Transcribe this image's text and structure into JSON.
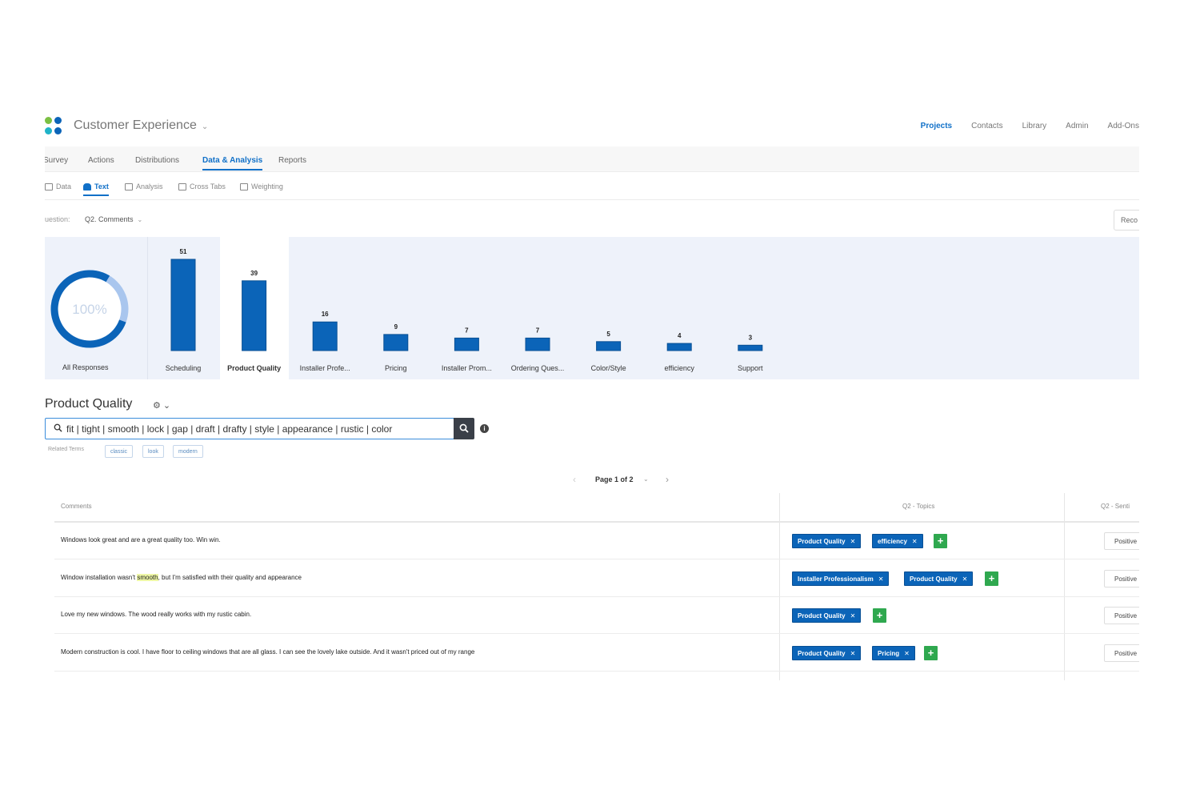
{
  "header": {
    "app_title": "Customer Experience",
    "logo_colors": [
      "#7bc043",
      "#0b64b8",
      "#1fb3c8",
      "#0b64b8"
    ],
    "top_nav": [
      "Projects",
      "Contacts",
      "Library",
      "Admin",
      "Add-Ons"
    ],
    "active_top_nav": "Projects"
  },
  "tabs": [
    "Survey",
    "Actions",
    "Distributions",
    "Data & Analysis",
    "Reports"
  ],
  "active_tab": "Data & Analysis",
  "subtabs": [
    "Data",
    "Text",
    "Analysis",
    "Cross Tabs",
    "Weighting"
  ],
  "active_subtab": "Text",
  "question": {
    "label": "uestion:",
    "value": "Q2. Comments",
    "right_button": "Reco"
  },
  "chart_data": {
    "type": "bar",
    "categories": [
      "Scheduling",
      "Product Quality",
      "Installer Profe...",
      "Pricing",
      "Installer Prom...",
      "Ordering Ques...",
      "Color/Style",
      "efficiency",
      "Support"
    ],
    "values": [
      51,
      39,
      16,
      9,
      7,
      7,
      5,
      4,
      3
    ],
    "selected": "Product Quality",
    "bar_color": "#0b64b8",
    "donut": {
      "label": "100%",
      "caption": "All Responses",
      "fraction": 1.0
    }
  },
  "section": {
    "title": "Product Quality",
    "search_query": "fit | tight | smooth | lock | gap | draft | drafty | style | appearance | rustic | color",
    "related_label": "Related Terms",
    "related_terms": [
      "classic",
      "look",
      "modern"
    ]
  },
  "pager": {
    "text": "Page 1 of 2"
  },
  "table": {
    "headers": [
      "Comments",
      "Q2 - Topics",
      "Q2 - Senti"
    ],
    "rows": [
      {
        "pre": "Windows look great and are a great quality too. Win win.",
        "highlight": "",
        "post": "",
        "topics": [
          "Product Quality",
          "efficiency"
        ],
        "sentiment": "Positive"
      },
      {
        "pre": "Window installation wasn't ",
        "highlight": "smooth",
        "post": ", but I'm satisfied with their quality and appearance",
        "topics": [
          "Installer Professionalism",
          "Product Quality"
        ],
        "sentiment": "Positive"
      },
      {
        "pre": "Love my new windows. The wood really works with my rustic cabin.",
        "highlight": "",
        "post": "",
        "topics": [
          "Product Quality"
        ],
        "sentiment": "Positive"
      },
      {
        "pre": "Modern construction is cool. I have floor to ceiling windows that are all glass. I can see the lovely lake outside. And it wasn't priced out of my range",
        "highlight": "",
        "post": "",
        "topics": [
          "Product Quality",
          "Pricing"
        ],
        "sentiment": "Positive"
      }
    ]
  }
}
